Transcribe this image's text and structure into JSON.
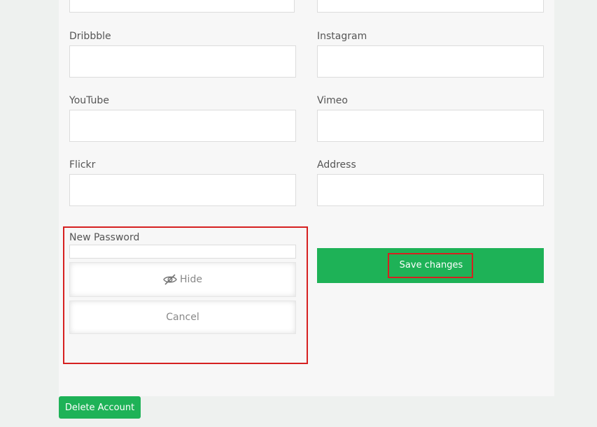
{
  "fields": {
    "dribbble_label": "Dribbble",
    "instagram_label": "Instagram",
    "youtube_label": "YouTube",
    "vimeo_label": "Vimeo",
    "flickr_label": "Flickr",
    "address_label": "Address"
  },
  "password": {
    "label": "New Password",
    "hide_label": "Hide",
    "cancel_label": "Cancel"
  },
  "actions": {
    "save_label": "Save changes",
    "delete_label": "Delete Account"
  },
  "colors": {
    "accent": "#1eb257",
    "highlight": "#d62020"
  },
  "icons": {
    "hide": "eye-slash-icon"
  }
}
